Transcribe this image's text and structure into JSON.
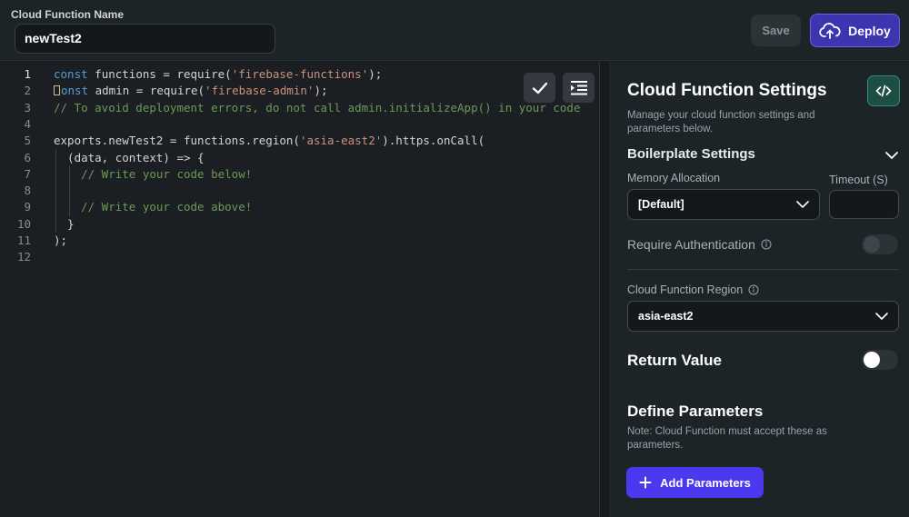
{
  "header": {
    "name_label": "Cloud Function Name",
    "name_value": "newTest2",
    "save_label": "Save",
    "deploy_label": "Deploy"
  },
  "editor": {
    "lines": [
      {
        "n": "1",
        "tokens": [
          {
            "t": "const",
            "c": "kw"
          },
          {
            "t": " functions = ",
            "c": ""
          },
          {
            "t": "require",
            "c": ""
          },
          {
            "t": "(",
            "c": ""
          },
          {
            "t": "'firebase-functions'",
            "c": "str"
          },
          {
            "t": ");",
            "c": ""
          }
        ]
      },
      {
        "n": "2",
        "tokens": [
          {
            "t": "onst",
            "c": "kw",
            "cursor": true
          },
          {
            "t": " admin = require(",
            "c": ""
          },
          {
            "t": "'firebase-admin'",
            "c": "str"
          },
          {
            "t": ");",
            "c": ""
          }
        ]
      },
      {
        "n": "3",
        "tokens": [
          {
            "t": "// To avoid deployment errors, do not call admin.initializeApp() in your code",
            "c": "cm"
          }
        ]
      },
      {
        "n": "4",
        "tokens": []
      },
      {
        "n": "5",
        "tokens": [
          {
            "t": "exports.newTest2 = functions.region(",
            "c": ""
          },
          {
            "t": "'asia-east2'",
            "c": "str"
          },
          {
            "t": ").https.onCall(",
            "c": ""
          }
        ]
      },
      {
        "n": "6",
        "tokens": [
          {
            "t": "  (data, context) => {",
            "c": ""
          }
        ]
      },
      {
        "n": "7",
        "tokens": [
          {
            "t": "    // Write your code below!",
            "c": "cm"
          }
        ]
      },
      {
        "n": "8",
        "tokens": []
      },
      {
        "n": "9",
        "tokens": [
          {
            "t": "    // Write your code above!",
            "c": "cm"
          }
        ]
      },
      {
        "n": "10",
        "tokens": [
          {
            "t": "  }",
            "c": ""
          }
        ]
      },
      {
        "n": "11",
        "tokens": [
          {
            "t": ");",
            "c": ""
          }
        ]
      },
      {
        "n": "12",
        "tokens": []
      }
    ],
    "check_icon": "check-icon",
    "format_icon": "format-indent-icon"
  },
  "settings": {
    "title": "Cloud Function Settings",
    "description": "Manage your cloud function settings and parameters below.",
    "boilerplate_title": "Boilerplate Settings",
    "memory_label": "Memory Allocation",
    "memory_value": "[Default]",
    "timeout_label": "Timeout (S)",
    "timeout_value": "",
    "require_auth_label": "Require Authentication",
    "require_auth_on": false,
    "region_label": "Cloud Function Region",
    "region_value": "asia-east2",
    "return_value_label": "Return Value",
    "return_value_on": false,
    "define_params_title": "Define Parameters",
    "define_params_note": "Note: Cloud Function must accept these as parameters.",
    "add_params_label": "Add Parameters"
  },
  "colors": {
    "accent": "#4b39ef",
    "deploy": "#3b35b0",
    "code_button": "#1e4d44"
  }
}
